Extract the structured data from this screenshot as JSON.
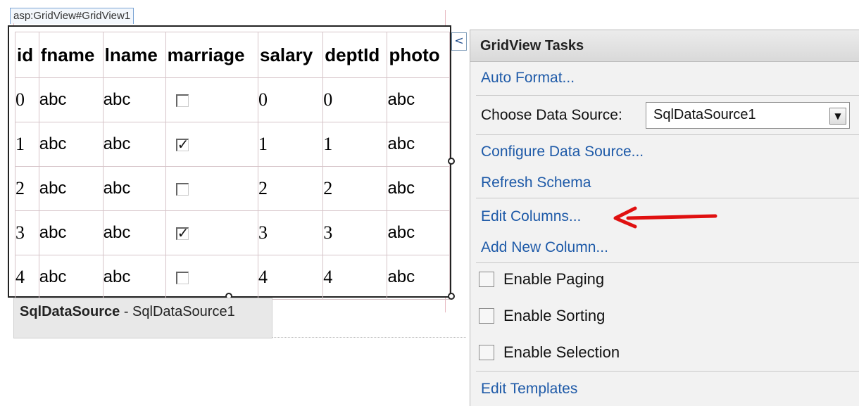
{
  "designer": {
    "control_tag": "asp:GridView#GridView1",
    "grid": {
      "columns": [
        "id",
        "fname",
        "lname",
        "marriage",
        "salary",
        "deptId",
        "photo"
      ],
      "rows": [
        {
          "id": "0",
          "fname": "abc",
          "lname": "abc",
          "marriage": false,
          "salary": "0",
          "deptId": "0",
          "photo": "abc"
        },
        {
          "id": "1",
          "fname": "abc",
          "lname": "abc",
          "marriage": true,
          "salary": "1",
          "deptId": "1",
          "photo": "abc"
        },
        {
          "id": "2",
          "fname": "abc",
          "lname": "abc",
          "marriage": false,
          "salary": "2",
          "deptId": "2",
          "photo": "abc"
        },
        {
          "id": "3",
          "fname": "abc",
          "lname": "abc",
          "marriage": true,
          "salary": "3",
          "deptId": "3",
          "photo": "abc"
        },
        {
          "id": "4",
          "fname": "abc",
          "lname": "abc",
          "marriage": false,
          "salary": "4",
          "deptId": "4",
          "photo": "abc"
        }
      ]
    },
    "datasource": {
      "type": "SqlDataSource",
      "separator": " - ",
      "name": "SqlDataSource1"
    },
    "smart_tag_glyph": "<"
  },
  "tasks": {
    "title": "GridView Tasks",
    "auto_format": "Auto Format...",
    "choose_label": "Choose Data Source:",
    "choose_value": "SqlDataSource1",
    "configure": "Configure Data Source...",
    "refresh": "Refresh Schema",
    "edit_columns": "Edit Columns...",
    "add_column": "Add New Column...",
    "paging": "Enable Paging",
    "sorting": "Enable Sorting",
    "selection": "Enable Selection",
    "edit_templates": "Edit Templates"
  },
  "colors": {
    "link": "#1e5aa8",
    "arrow": "#e01010"
  },
  "icons": {
    "dropdown": "chevron-down-icon",
    "annotation": "red-arrow-icon",
    "smart_tag": "chevron-left-icon"
  }
}
